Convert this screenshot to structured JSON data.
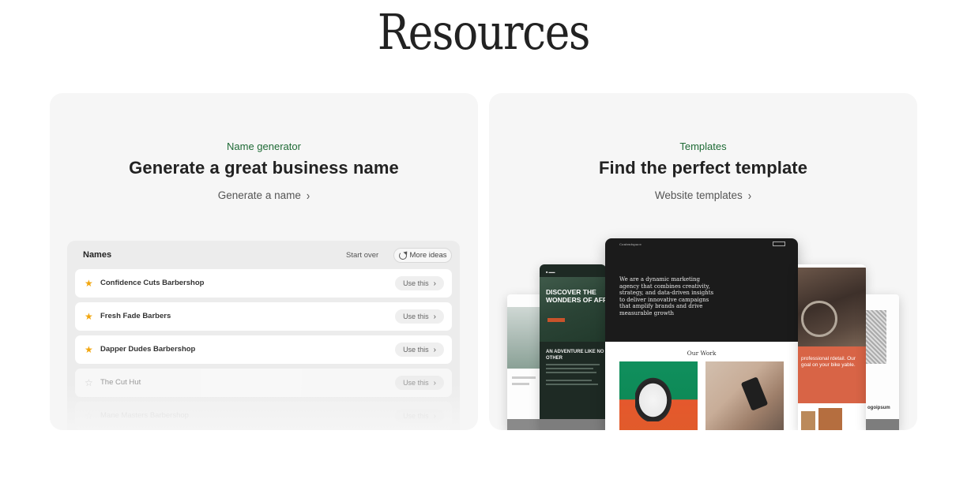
{
  "page": {
    "title": "Resources"
  },
  "name_generator": {
    "eyebrow": "Name generator",
    "heading": "Generate a great business name",
    "cta_label": "Generate a name",
    "panel": {
      "title": "Names",
      "start_over_label": "Start over",
      "more_ideas_label": "More ideas",
      "use_label": "Use this",
      "items": [
        {
          "name": "Confidence Cuts Barbershop",
          "starred": true
        },
        {
          "name": "Fresh Fade Barbers",
          "starred": true
        },
        {
          "name": "Dapper Dudes Barbershop",
          "starred": true
        },
        {
          "name": "The Cut Hut",
          "starred": false
        },
        {
          "name": "Mane Masters Barbershop",
          "starred": false
        }
      ]
    }
  },
  "templates": {
    "eyebrow": "Templates",
    "heading": "Find the perfect template",
    "cta_label": "Website templates",
    "preview": {
      "left_hero": "DISCOVER THE WONDERS OF AFR",
      "left_sub": "AN ADVENTURE LIKE NO OTHER",
      "center_brand": "Contentspace",
      "center_tagline": "We are a dynamic marketing agency that combines creativity, strategy, and data-driven insights to deliver innovative campaigns that amplify brands and drive measurable growth",
      "center_work_title": "Our Work",
      "right_text": "professional rdetail. Our goal on your bike yable.",
      "far_right_logo": "ogoipsum"
    }
  },
  "icons": {
    "chevron": "chevron-right-icon",
    "star": "star-icon",
    "refresh": "refresh-icon"
  },
  "colors": {
    "accent_green": "#1f6b36",
    "star_gold": "#f2a60f",
    "card_bg": "#f6f6f6"
  }
}
